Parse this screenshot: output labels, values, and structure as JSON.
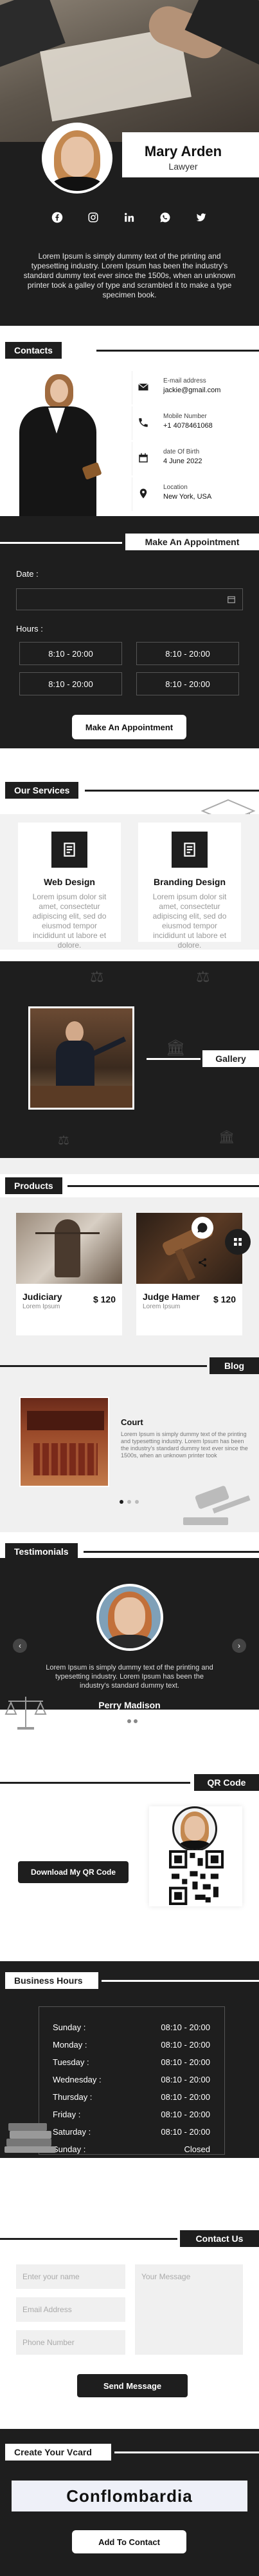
{
  "profile": {
    "name": "Mary Arden",
    "job_title": "Lawyer",
    "bio": "Lorem Ipsum is simply dummy text of the printing and typesetting industry. Lorem Ipsum has been the industry's standard dummy text ever since the 1500s, when an unknown printer took a galley of type and scrambled it to make a type specimen book.",
    "social_icons": [
      "facebook-icon",
      "instagram-icon",
      "linkedin-icon",
      "whatsapp-icon",
      "twitter-icon"
    ]
  },
  "contacts": {
    "title": "Contacts",
    "items": [
      {
        "label": "E-mail address",
        "value": "jackie@gmail.com",
        "icon": "email-icon"
      },
      {
        "label": "Mobile Number",
        "value": "+1 4078461068",
        "icon": "phone-icon"
      },
      {
        "label": "date Of Birth",
        "value": "4 June 2022",
        "icon": "calendar-icon"
      },
      {
        "label": "Location",
        "value": "New York, USA",
        "icon": "location-icon"
      }
    ]
  },
  "appointment": {
    "title": "Make An Appointment",
    "date_label": "Date :",
    "hours_label": "Hours :",
    "slots": [
      "8:10 - 20:00",
      "8:10 - 20:00",
      "8:10 - 20:00",
      "8:10 - 20:00"
    ],
    "button": "Make An Appointment"
  },
  "services": {
    "title": "Our Services",
    "items": [
      {
        "name": "Web Design",
        "text": "Lorem ipsum dolor sit amet, consectetur adipiscing elit, sed do eiusmod tempor incididunt ut labore et dolore."
      },
      {
        "name": "Branding Design",
        "text": "Lorem ipsum dolor sit amet, consectetur adipiscing elit, sed do eiusmod tempor incididunt ut labore et dolore."
      }
    ]
  },
  "gallery": {
    "title": "Gallery"
  },
  "products": {
    "title": "Products",
    "items": [
      {
        "name": "Judiciary",
        "sub": "Lorem Ipsum",
        "price": "$ 120"
      },
      {
        "name": "Judge Hamer",
        "sub": "Lorem Ipsum",
        "price": "$ 120"
      }
    ]
  },
  "blog": {
    "title": "Blog",
    "post_title": "Court",
    "post_text": "Lorem Ipsum is simply dummy text of the printing and typesetting industry. Lorem Ipsum has been the industry's standard dummy text ever since the 1500s, when an unknown printer took"
  },
  "testimonials": {
    "title": "Testimonials",
    "text": "Lorem Ipsum is simply dummy text of the printing and typesetting industry. Lorem Ipsum has been the industry's standard dummy text.",
    "author": "Perry Madison"
  },
  "qr": {
    "title": "QR Code",
    "button": "Download My QR Code"
  },
  "hours": {
    "title": "Business Hours",
    "rows": [
      {
        "day": "Sunday :",
        "time": "08:10 - 20:00"
      },
      {
        "day": "Monday :",
        "time": "08:10 - 20:00"
      },
      {
        "day": "Tuesday :",
        "time": "08:10 - 20:00"
      },
      {
        "day": "Wednesday :",
        "time": "08:10 - 20:00"
      },
      {
        "day": "Thursday :",
        "time": "08:10 - 20:00"
      },
      {
        "day": "Friday :",
        "time": "08:10 - 20:00"
      },
      {
        "day": "Saturday :",
        "time": "08:10 - 20:00"
      },
      {
        "day": "Sunday :",
        "time": "Closed"
      }
    ]
  },
  "contact_us": {
    "title": "Contact Us",
    "name_placeholder": "Enter your name",
    "email_placeholder": "Email Address",
    "phone_placeholder": "Phone Number",
    "message_placeholder": "Your Message",
    "button": "Send Message"
  },
  "vcard": {
    "title": "Create Your Vcard",
    "brand": "Conflombardia",
    "button": "Add To Contact"
  }
}
